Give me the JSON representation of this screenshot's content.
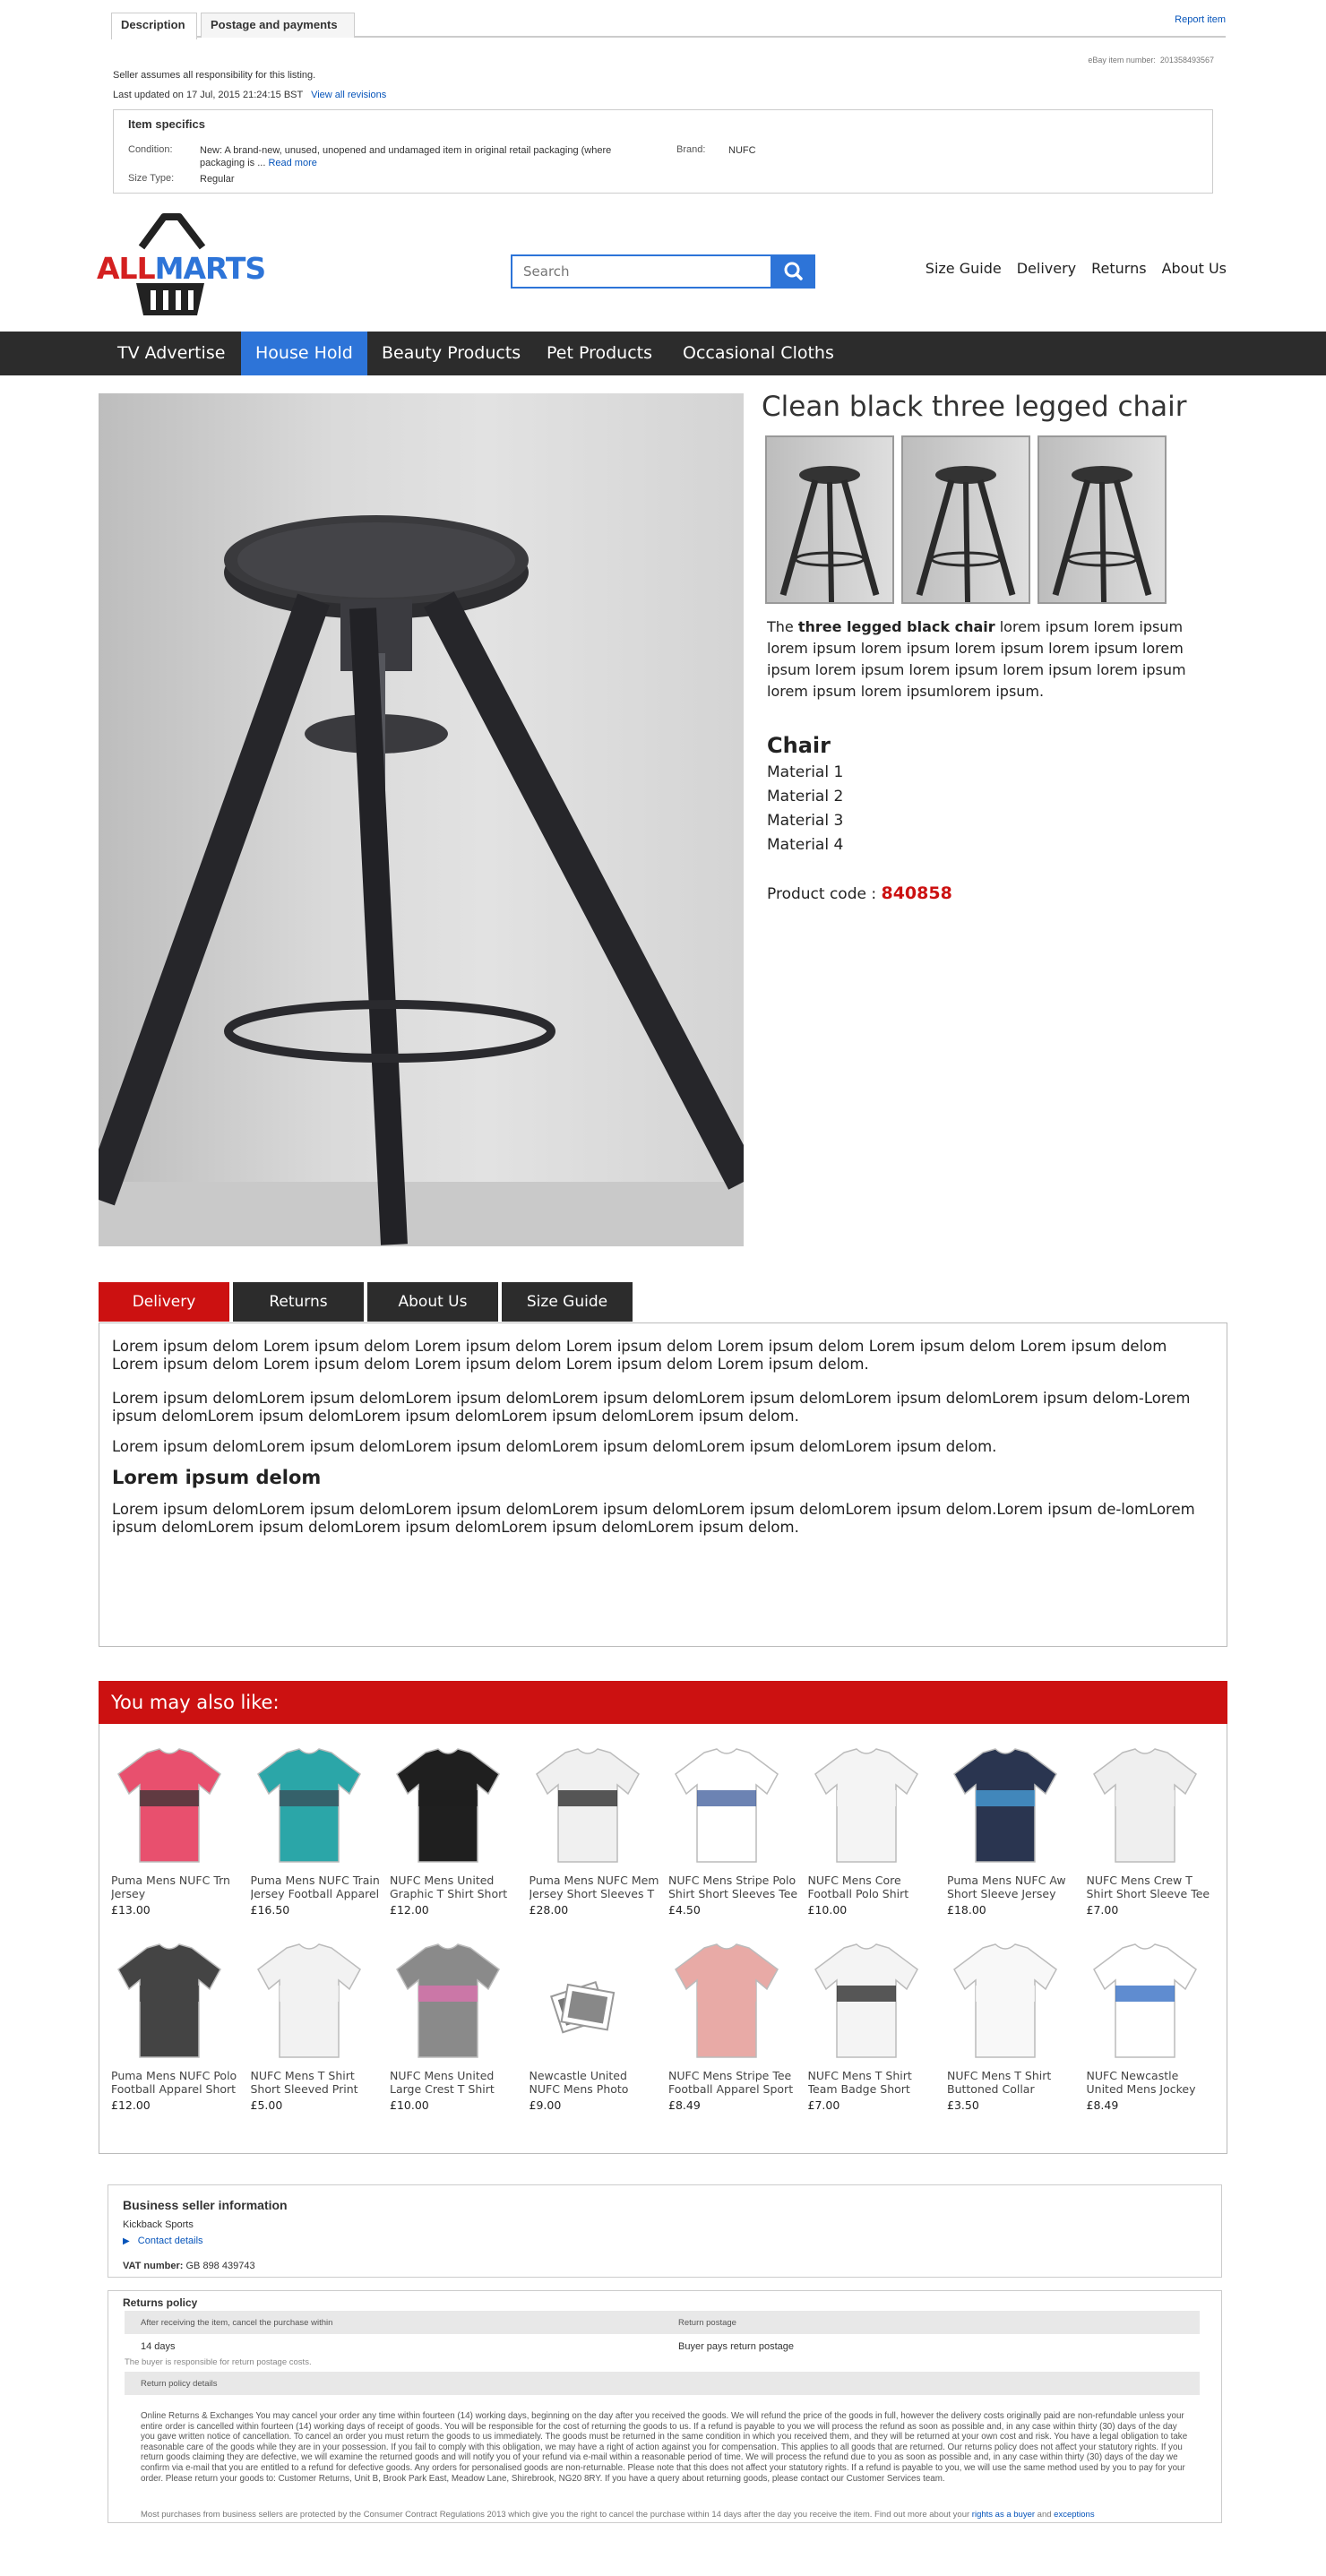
{
  "ebay": {
    "tabs": [
      "Description",
      "Postage and payments"
    ],
    "report_item": "Report item",
    "item_number_label": "eBay item number:",
    "item_number": "201358493567",
    "seller_responsibility": "Seller assumes all responsibility for this listing.",
    "last_updated_label": "Last updated on",
    "last_updated": "17 Jul, 2015 21:24:15 BST",
    "view_revisions": "View all revisions",
    "specifics": {
      "title": "Item specifics",
      "condition_label": "Condition:",
      "condition_value": "New: A brand-new, unused, unopened and undamaged item in original retail packaging (where packaging is ...",
      "read_more": "Read more",
      "brand_label": "Brand:",
      "brand_value": "NUFC",
      "size_type_label": "Size Type:",
      "size_type_value": "Regular"
    }
  },
  "store": {
    "logo_left": "ALL",
    "logo_right": "MARTS",
    "search_placeholder": "Search",
    "top_links": [
      "Size Guide",
      "Delivery",
      "Returns",
      "About Us"
    ],
    "nav": [
      "TV Advertise",
      "House Hold",
      "Beauty Products",
      "Pet Products",
      "Occasional Cloths"
    ],
    "nav_active": "House Hold"
  },
  "product": {
    "title": "Clean black three legged chair",
    "desc_pre": "The ",
    "desc_bold": "three legged black chair",
    "desc_post": " lorem ipsum lorem ipsum lorem ipsum lorem ipsum lorem ipsum lorem ipsum lorem ipsum lorem ipsum lorem ipsum lorem ipsum lorem ipsum lorem ipsum lorem ipsumlorem ipsum.",
    "spec_heading": "Chair",
    "materials": [
      "Material 1",
      "Material 2",
      "Material 3",
      "Material 4"
    ],
    "code_label": "Product code : ",
    "code": "840858"
  },
  "info_tabs": {
    "tabs": [
      "Delivery",
      "Returns",
      "About Us",
      "Size Guide"
    ],
    "active": "Delivery",
    "p1": "Lorem ipsum delom Lorem ipsum delom Lorem ipsum delom Lorem ipsum delom Lorem ipsum delom Lorem ipsum delom Lorem ipsum delom Lorem ipsum delom Lorem ipsum delom Lorem ipsum delom Lorem ipsum delom Lorem ipsum delom.",
    "p2": "Lorem ipsum delomLorem ipsum delomLorem ipsum delomLorem ipsum delomLorem ipsum delomLorem ipsum delomLorem ipsum delom-Lorem ipsum delomLorem ipsum delomLorem ipsum delomLorem ipsum delomLorem ipsum delom.",
    "p3": "Lorem ipsum delomLorem ipsum delomLorem ipsum delomLorem ipsum delomLorem ipsum delomLorem ipsum delom.",
    "heading": "Lorem ipsum delom",
    "p4": "Lorem ipsum delomLorem ipsum delomLorem ipsum delomLorem ipsum delomLorem ipsum delomLorem ipsum delom.Lorem ipsum de-lomLorem ipsum delomLorem ipsum delomLorem ipsum delomLorem ipsum delomLorem ipsum delom."
  },
  "also_like": {
    "heading": "You may also like:",
    "items": [
      {
        "name": "Puma Mens NUFC Trn Jersey",
        "price": "£13.00",
        "color": "#e8506e",
        "accent": "#333"
      },
      {
        "name": "Puma Mens NUFC Train Jersey Football Apparel",
        "price": "£16.50",
        "color": "#2ba6a8",
        "accent": "#3a4a55"
      },
      {
        "name": "NUFC Mens United Graphic T Shirt Short",
        "price": "£12.00",
        "color": "#1f1f1f",
        "accent": "#1f1f1f"
      },
      {
        "name": "Puma Mens NUFC Mem Jersey Short Sleeves T",
        "price": "£28.00",
        "color": "#f0f0f0",
        "accent": "#222"
      },
      {
        "name": "NUFC Mens Stripe Polo Shirt Short Sleeves Tee",
        "price": "£4.50",
        "color": "#ffffff",
        "accent": "#3b5a99"
      },
      {
        "name": "NUFC Mens Core Football Polo Shirt Short",
        "price": "£10.00",
        "color": "#f4f4f4",
        "accent": "#f4f4f4"
      },
      {
        "name": "Puma Mens NUFC Aw Short Sleeve Jersey",
        "price": "£18.00",
        "color": "#2a3550",
        "accent": "#4aa3df"
      },
      {
        "name": "NUFC Mens Crew T Shirt Short Sleeve Tee Top",
        "price": "£7.00",
        "color": "#efefef",
        "accent": "#efefef"
      },
      {
        "name": "Puma Mens NUFC Polo Football Apparel Short",
        "price": "£12.00",
        "color": "#444444",
        "accent": "#444444"
      },
      {
        "name": "NUFC Mens T Shirt Short Sleeved Print Cotton",
        "price": "£5.00",
        "color": "#f2f2f2",
        "accent": "#f2f2f2"
      },
      {
        "name": "NUFC Mens United Large Crest T Shirt Short",
        "price": "£10.00",
        "color": "#8a8a8a",
        "accent": "#e070b0"
      },
      {
        "name": "Newcastle United NUFC Mens Photo Tshirt Tee",
        "price": "£9.00",
        "color": "#ffffff",
        "accent": "#888"
      },
      {
        "name": "NUFC Mens Stripe Tee Football Apparel Sport T",
        "price": "£8.49",
        "color": "#e8aaa6",
        "accent": "#e8aaa6"
      },
      {
        "name": "NUFC Mens T Shirt Team Badge Short Sleeved",
        "price": "£7.00",
        "color": "#f4f4f4",
        "accent": "#222"
      },
      {
        "name": "NUFC Mens T Shirt Buttoned Collar",
        "price": "£3.50",
        "color": "#f8f8f8",
        "accent": "#f8f8f8"
      },
      {
        "name": "NUFC Newcastle United Mens Jockey Polo Shirt",
        "price": "£8.49",
        "color": "#ffffff",
        "accent": "#2a66c0"
      }
    ]
  },
  "seller": {
    "title": "Business seller information",
    "name": "Kickback Sports",
    "contact": "Contact details",
    "vat_label": "VAT number:",
    "vat": "GB 898 439743"
  },
  "returns": {
    "title": "Returns policy",
    "col1": "After receiving the item, cancel the purchase within",
    "col2": "Return postage",
    "days": "14 days",
    "payer": "Buyer pays return postage",
    "note": "The buyer is responsible for return postage costs.",
    "details_label": "Return policy details",
    "policy": "Online Returns & Exchanges You may cancel your order any time within fourteen (14) working days, beginning on the day after you received the goods. We will refund the price of the goods in full, however the delivery costs originally paid are non-refundable unless your entire order is cancelled within fourteen (14) working days of receipt of goods. You will be responsible for the cost of returning the goods to us. If a refund is payable to you we will process the refund as soon as possible and, in any case within thirty (30) days of the day you gave written notice of cancellation. To cancel an order you must return the goods to us immediately. The goods must be returned in the same condition in which you received them, and they will be returned at your own cost and risk. You have a legal obligation to take reasonable care of the goods while they are in your possession. If you fail to comply with this obligation, we may have a right of action against you for compensation. This applies to all goods that are returned. Our returns policy does not affect your statutory rights. If you return goods claiming they are defective, we will examine the returned goods and will notify you of your refund via e-mail within a reasonable period of time. We will process the refund due to you as soon as possible and, in any case within thirty (30) days of the day we confirm via e-mail that you are entitled to a refund for defective goods. Any orders for personalised goods are non-returnable. Please note that this does not affect your statutory rights. If a refund is payable to you, we will use the same method used by you to pay for your order. Please return your goods to: Customer Returns, Unit B, Brook Park East, Meadow Lane, Shirebrook, NG20 8RY. If you have a query about returning goods, please contact our Customer Services team.",
    "footer_pre": "Most purchases from business sellers are protected by the Consumer Contract Regulations 2013 which give you the right to cancel the purchase within 14 days after the day you receive the item. Find out more about your",
    "footer_link1": "rights as a buyer",
    "footer_and": "and",
    "footer_link2": "exceptions"
  }
}
